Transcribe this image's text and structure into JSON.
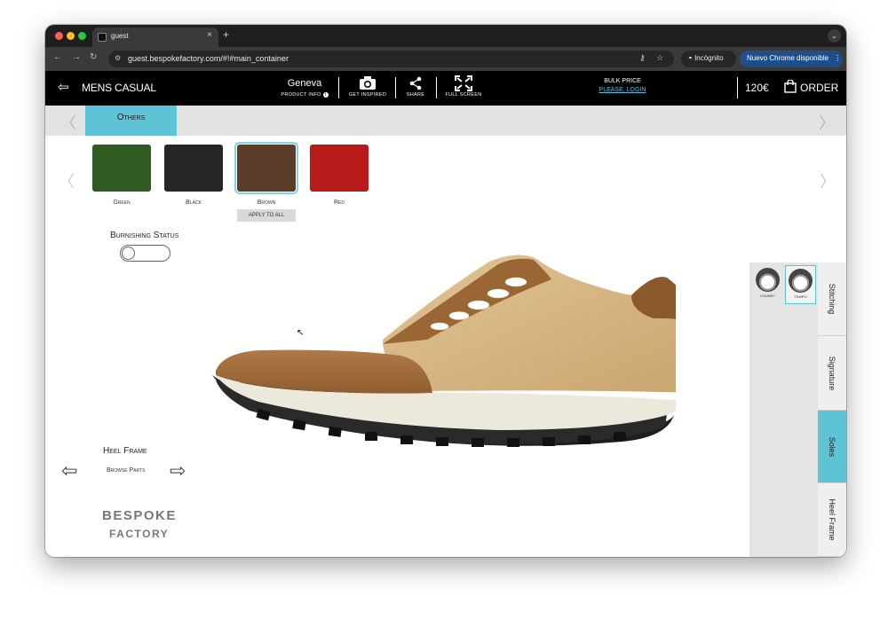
{
  "browser": {
    "tab_title": "guest",
    "tab_close": "×",
    "new_tab": "+",
    "url": "guest.bespokefactory.com/#!#main_container",
    "incognito_label": "Incógnito",
    "update_label": "Nuevo Chrome disponible"
  },
  "header": {
    "title": "MENS CASUAL",
    "product_name": "Geneva",
    "product_info": "PRODUCT INFO",
    "get_inspired": "GET INSPIRED",
    "share": "SHARE",
    "full_screen": "FULL SCREEN",
    "bulk_price": "BULK PRICE",
    "login_link": "PLEASE, LOGIN",
    "price": "120€",
    "order": "ORDER"
  },
  "category": {
    "active_tab": "Others"
  },
  "swatches": [
    {
      "label": "Green",
      "color": "#2f5a22"
    },
    {
      "label": "Black",
      "color": "#262626"
    },
    {
      "label": "Brown",
      "color": "#5a3d29",
      "selected": true
    },
    {
      "label": "Red",
      "color": "#b81a1a"
    }
  ],
  "apply_all": "APPLY TO ALL",
  "burnishing": {
    "label": "Burnishing Status",
    "enabled": false
  },
  "part_nav": {
    "title": "Heel Frame",
    "subtitle": "Browse Parts"
  },
  "brand": {
    "line1": "BESPOKE",
    "line2": "FACTORY"
  },
  "sole_options": [
    {
      "label": "CHUNKY"
    },
    {
      "label": "TEMPO",
      "selected": true
    }
  ],
  "side_tabs": [
    {
      "label": "Stitching"
    },
    {
      "label": "Signature"
    },
    {
      "label": "Soles",
      "active": true
    },
    {
      "label": "Heel Frame"
    }
  ]
}
